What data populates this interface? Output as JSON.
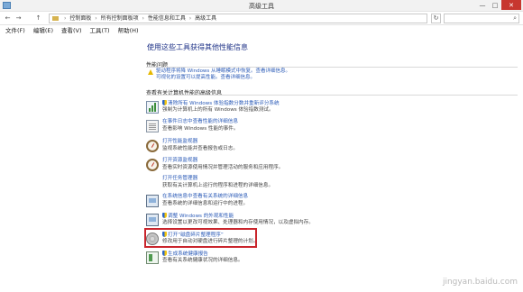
{
  "window": {
    "title": "高级工具",
    "minimize": "—",
    "maximize": "□",
    "close": "✕"
  },
  "address": {
    "segments": [
      "控制面板",
      "所有控制面板项",
      "性能信息和工具",
      "高级工具"
    ],
    "separator": "›",
    "back_icon": "←",
    "forward_icon": "→",
    "up_icon": "↑",
    "refresh_icon": "↻",
    "search_icon": "⌕"
  },
  "menu": [
    "文件(F)",
    "编辑(E)",
    "查看(V)",
    "工具(T)",
    "帮助(H)"
  ],
  "page": {
    "heading": "使用这些工具获得其他性能信息",
    "perf_section": "性能问题",
    "perf_link_line1": "驱动程序将降 Windows 从睡眠模式中恢复。查看详细信息。",
    "perf_link_line2": "可视化的设置可以提高性能。查看详细信息。",
    "advanced_section": "查看有关计算机性能的高级信息"
  },
  "tools": [
    {
      "title": "清除所有 Windows 体验指数分数并重新评分系统",
      "desc": "强制为计算机上的所有 Windows 体验指数测试。",
      "shield": true
    },
    {
      "title": "在事件日志中查看性能的详细信息",
      "desc": "查看影响 Windows 性能的事件。",
      "shield": false
    },
    {
      "title": "打开性能监视器",
      "desc": "监视系统性能并查看报告或日志。",
      "shield": false
    },
    {
      "title": "打开资源监视器",
      "desc": "查看实时资源使用情况并管理活动的服务和应用程序。",
      "shield": false
    },
    {
      "title": "打开任务管理器",
      "desc": "获取有关计算机上运行的程序和进程的详细信息。",
      "shield": false
    },
    {
      "title": "在系统信息中查看有关系统的详细信息",
      "desc": "查看系统的详细信息和运行中的进程。",
      "shield": false
    },
    {
      "title": "调整 Windows 的外观和性能",
      "desc": "选择设置以更改可视效果、处理器和内存使用情况，以及虚拟内存。",
      "shield": true
    },
    {
      "title": "打开“磁盘碎片整理程序”",
      "desc": "修改用于自动对硬盘进行碎片整理的计划。",
      "shield": true
    },
    {
      "title": "生成系统健康报告",
      "desc": "查看有关系统健康状况的详细信息。",
      "shield": true
    }
  ],
  "watermark": "jingyan.baidu.com"
}
